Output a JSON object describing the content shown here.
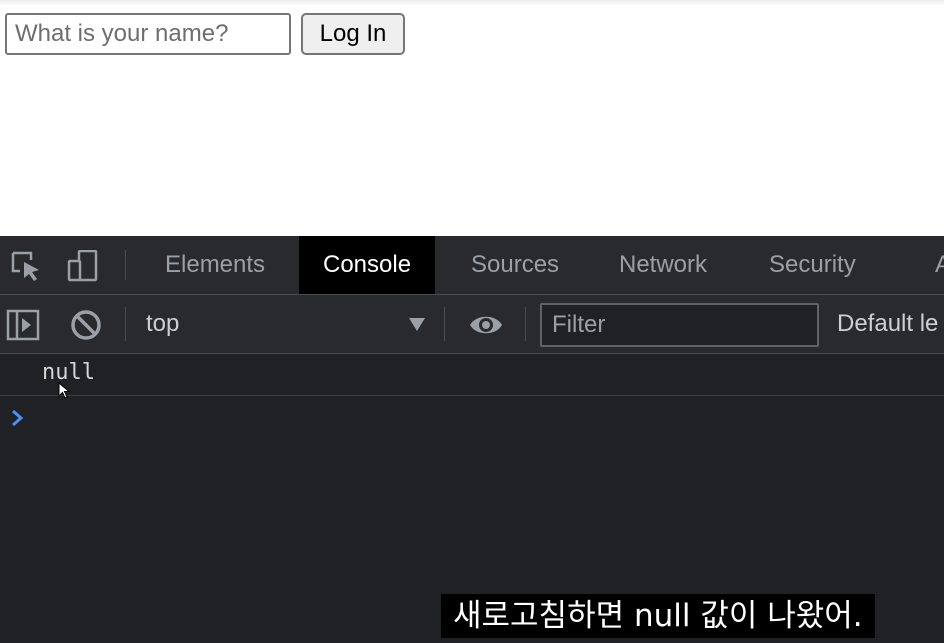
{
  "page": {
    "name_input": {
      "placeholder": "What is your name?",
      "value": ""
    },
    "login_button": "Log In"
  },
  "devtools": {
    "tabs": [
      "Elements",
      "Console",
      "Sources",
      "Network",
      "Security",
      "A"
    ],
    "active_tab": "Console",
    "toolbar": {
      "context": "top",
      "filter_placeholder": "Filter",
      "levels": "Default le"
    },
    "console": {
      "messages": [
        "null"
      ]
    },
    "colors": {
      "background": "#202124",
      "toolbar": "#292a2d",
      "prompt": "#4c8df6"
    }
  },
  "subtitle": "새로고침하면 null 값이 나왔어."
}
